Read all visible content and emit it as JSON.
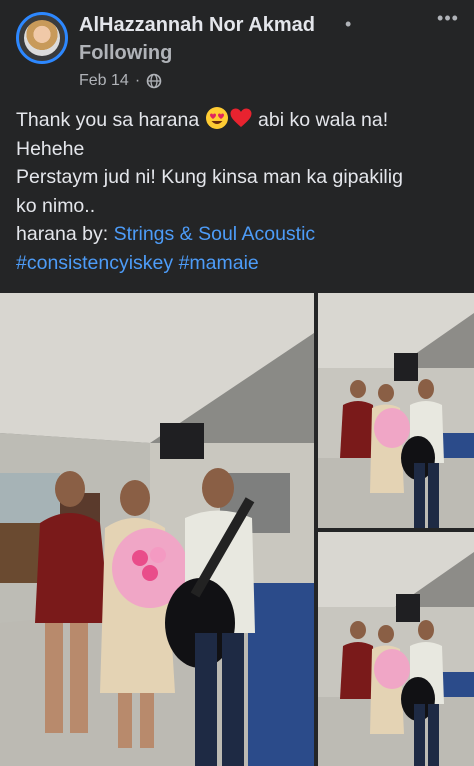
{
  "post": {
    "author": "AlHazzannah Nor Akmad",
    "separator": "•",
    "follow_status": "Following",
    "date": "Feb 14",
    "date_separator": "·",
    "privacy_icon": "globe-icon",
    "more_icon": "more-options-icon",
    "more_label": "•••"
  },
  "text": {
    "line1_a": "Thank you sa harana ",
    "line1_b": " abi ko wala na!",
    "emojis": [
      "heart-eyes-emoji",
      "red-heart-emoji"
    ],
    "line2": "Hehehe",
    "line3": "Perstaym jud ni! Kung kinsa man ka gipakilig",
    "line4": "ko nimo..",
    "credit_prefix": "harana by: ",
    "credit_link": "Strings & Soul Acoustic",
    "hashtag1": "#consistencyiskey",
    "hashtag2": "#mamaie"
  },
  "photos": {
    "count": 3,
    "description_icons": [
      "photo-main",
      "photo-top-right",
      "photo-bottom-right"
    ]
  },
  "colors": {
    "background": "#242526",
    "text": "#e4e6eb",
    "secondary": "#b0b3b8",
    "link": "#4d9cf8",
    "avatar_ring": "#2d88ff"
  }
}
